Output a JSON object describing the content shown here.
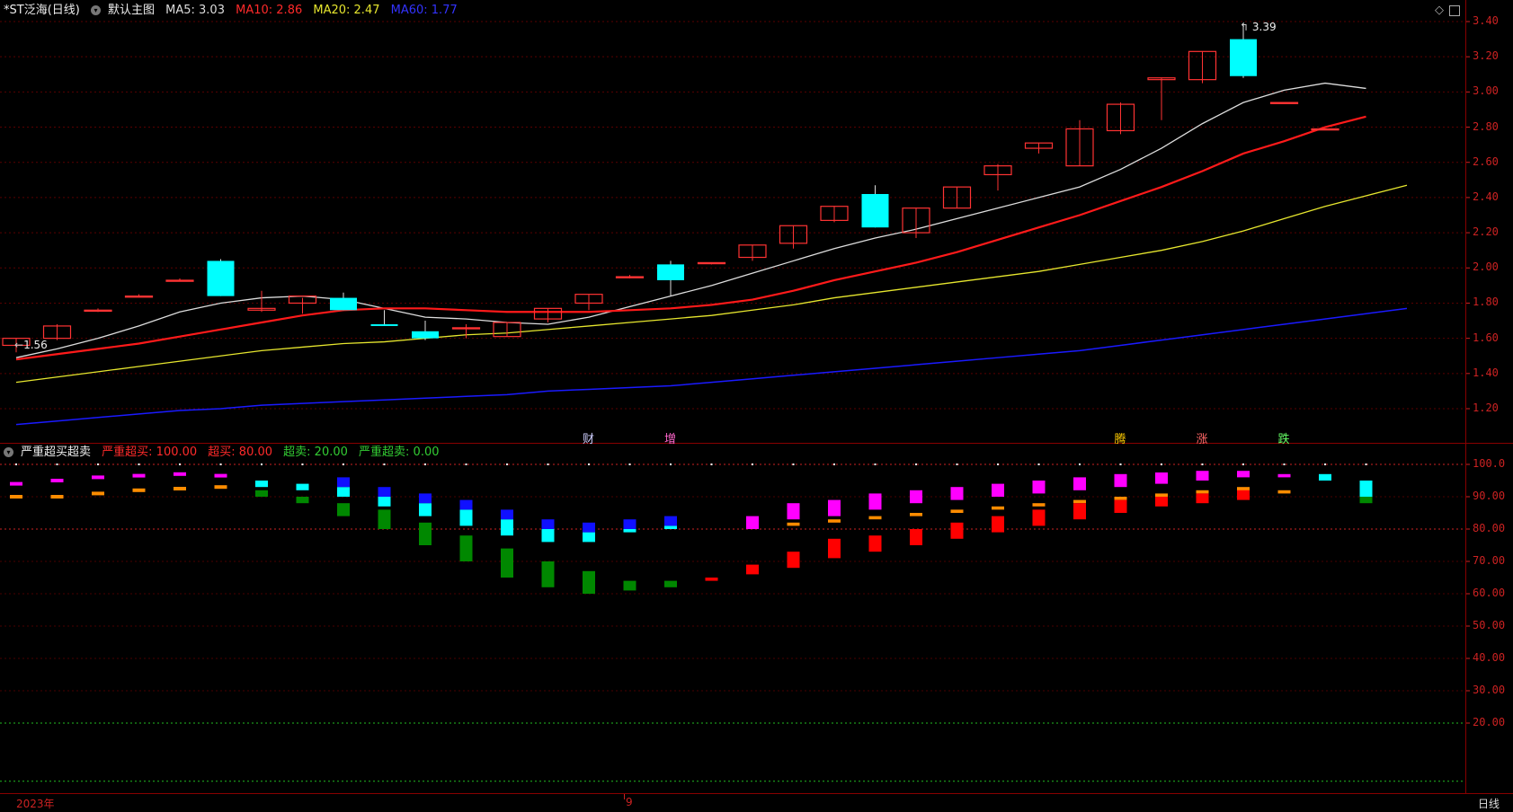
{
  "main": {
    "stock": "*ST泛海(日线)",
    "template": "默认主图",
    "ma5_label": "MA5: 3.03",
    "ma10_label": "MA10: 2.86",
    "ma20_label": "MA20: 2.47",
    "ma60_label": "MA60: 1.77",
    "colors": {
      "ma5": "#dddddd",
      "ma10": "#ff1a1a",
      "ma20": "#e6e62e",
      "ma60": "#1a1aff",
      "up": "#ff3333",
      "down": "#00ffff"
    },
    "high_label": "3.39",
    "low_label": "1.56",
    "events": [
      {
        "label": "财",
        "color": "#cfcfff"
      },
      {
        "label": "增",
        "color": "#ff66cc"
      },
      {
        "label": "腾",
        "color": "#ffcc00"
      },
      {
        "label": "涨",
        "color": "#ff6666"
      },
      {
        "label": "跌",
        "color": "#66ff66"
      }
    ],
    "ticks": [
      "3.40",
      "3.20",
      "3.00",
      "2.80",
      "2.60",
      "2.40",
      "2.20",
      "2.00",
      "1.80",
      "1.60",
      "1.40",
      "1.20"
    ]
  },
  "indicator": {
    "name": "严重超买超卖",
    "l1": "严重超买: 100.00",
    "l2": "超买: 80.00",
    "l3": "超卖: 20.00",
    "l4": "严重超卖: 0.00",
    "ticks": [
      "100.0",
      "90.00",
      "80.00",
      "70.00",
      "60.00",
      "50.00",
      "40.00",
      "30.00",
      "20.00"
    ]
  },
  "footer": {
    "year": "2023年",
    "month": "9",
    "period": "日线"
  },
  "chart_data": [
    {
      "type": "candlestick",
      "title": "*ST泛海(日线)",
      "ylim": [
        1.1,
        3.45
      ],
      "candles": [
        {
          "o": 1.56,
          "h": 1.6,
          "l": 1.52,
          "c": 1.6
        },
        {
          "o": 1.6,
          "h": 1.68,
          "l": 1.59,
          "c": 1.67
        },
        {
          "o": 1.76,
          "h": 1.77,
          "l": 1.75,
          "c": 1.76
        },
        {
          "o": 1.84,
          "h": 1.85,
          "l": 1.84,
          "c": 1.84
        },
        {
          "o": 1.93,
          "h": 1.94,
          "l": 1.93,
          "c": 1.93
        },
        {
          "o": 2.04,
          "h": 2.05,
          "l": 1.84,
          "c": 1.84
        },
        {
          "o": 1.76,
          "h": 1.87,
          "l": 1.75,
          "c": 1.77
        },
        {
          "o": 1.8,
          "h": 1.83,
          "l": 1.74,
          "c": 1.84
        },
        {
          "o": 1.83,
          "h": 1.86,
          "l": 1.76,
          "c": 1.76
        },
        {
          "o": 1.68,
          "h": 1.76,
          "l": 1.67,
          "c": 1.67
        },
        {
          "o": 1.64,
          "h": 1.7,
          "l": 1.59,
          "c": 1.6
        },
        {
          "o": 1.66,
          "h": 1.68,
          "l": 1.6,
          "c": 1.66
        },
        {
          "o": 1.61,
          "h": 1.69,
          "l": 1.61,
          "c": 1.69
        },
        {
          "o": 1.71,
          "h": 1.77,
          "l": 1.69,
          "c": 1.77
        },
        {
          "o": 1.8,
          "h": 1.85,
          "l": 1.76,
          "c": 1.85
        },
        {
          "o": 1.95,
          "h": 1.96,
          "l": 1.94,
          "c": 1.95
        },
        {
          "o": 2.02,
          "h": 2.04,
          "l": 1.84,
          "c": 1.93
        },
        {
          "o": 2.03,
          "h": 2.03,
          "l": 2.02,
          "c": 2.03
        },
        {
          "o": 2.06,
          "h": 2.13,
          "l": 2.04,
          "c": 2.13
        },
        {
          "o": 2.14,
          "h": 2.24,
          "l": 2.11,
          "c": 2.24
        },
        {
          "o": 2.27,
          "h": 2.35,
          "l": 2.26,
          "c": 2.35
        },
        {
          "o": 2.42,
          "h": 2.47,
          "l": 2.23,
          "c": 2.23
        },
        {
          "o": 2.2,
          "h": 2.34,
          "l": 2.17,
          "c": 2.34
        },
        {
          "o": 2.34,
          "h": 2.46,
          "l": 2.34,
          "c": 2.46
        },
        {
          "o": 2.53,
          "h": 2.59,
          "l": 2.44,
          "c": 2.58
        },
        {
          "o": 2.68,
          "h": 2.71,
          "l": 2.65,
          "c": 2.71
        },
        {
          "o": 2.58,
          "h": 2.84,
          "l": 2.58,
          "c": 2.79
        },
        {
          "o": 2.78,
          "h": 2.94,
          "l": 2.76,
          "c": 2.93
        },
        {
          "o": 3.07,
          "h": 3.08,
          "l": 2.84,
          "c": 3.08
        },
        {
          "o": 3.07,
          "h": 3.23,
          "l": 3.05,
          "c": 3.23
        },
        {
          "o": 3.3,
          "h": 3.39,
          "l": 3.08,
          "c": 3.09
        },
        {
          "o": 2.94,
          "h": 2.94,
          "l": 2.94,
          "c": 2.94
        },
        {
          "o": 2.79,
          "h": 2.79,
          "l": 2.79,
          "c": 2.79
        }
      ],
      "series": [
        {
          "name": "MA5",
          "values": [
            1.49,
            1.54,
            1.6,
            1.67,
            1.75,
            1.8,
            1.83,
            1.84,
            1.82,
            1.77,
            1.72,
            1.71,
            1.69,
            1.68,
            1.72,
            1.78,
            1.84,
            1.9,
            1.97,
            2.04,
            2.11,
            2.17,
            2.22,
            2.28,
            2.34,
            2.4,
            2.46,
            2.56,
            2.68,
            2.82,
            2.94,
            3.01,
            3.05,
            3.02
          ]
        },
        {
          "name": "MA10",
          "values": [
            1.48,
            1.51,
            1.54,
            1.57,
            1.61,
            1.65,
            1.69,
            1.73,
            1.76,
            1.77,
            1.77,
            1.76,
            1.75,
            1.75,
            1.75,
            1.76,
            1.77,
            1.79,
            1.82,
            1.87,
            1.93,
            1.98,
            2.03,
            2.09,
            2.16,
            2.23,
            2.3,
            2.38,
            2.46,
            2.55,
            2.65,
            2.72,
            2.8,
            2.86
          ]
        },
        {
          "name": "MA20",
          "values": [
            1.35,
            1.38,
            1.41,
            1.44,
            1.47,
            1.5,
            1.53,
            1.55,
            1.57,
            1.58,
            1.6,
            1.62,
            1.63,
            1.65,
            1.67,
            1.69,
            1.71,
            1.73,
            1.76,
            1.79,
            1.83,
            1.86,
            1.89,
            1.92,
            1.95,
            1.98,
            2.02,
            2.06,
            2.1,
            2.15,
            2.21,
            2.28,
            2.35,
            2.41,
            2.47
          ]
        },
        {
          "name": "MA60",
          "values": [
            1.11,
            1.13,
            1.15,
            1.17,
            1.19,
            1.2,
            1.22,
            1.23,
            1.24,
            1.25,
            1.26,
            1.27,
            1.28,
            1.3,
            1.31,
            1.32,
            1.33,
            1.35,
            1.37,
            1.39,
            1.41,
            1.43,
            1.45,
            1.47,
            1.49,
            1.51,
            1.53,
            1.56,
            1.59,
            1.62,
            1.65,
            1.68,
            1.71,
            1.74,
            1.77
          ]
        }
      ]
    },
    {
      "type": "bar",
      "title": "严重超买超卖",
      "ylim": [
        15,
        102
      ],
      "bars": [
        {
          "m": 94,
          "o": 90,
          "c": null,
          "g": null
        },
        {
          "m": 95,
          "o": 90,
          "c": null,
          "g": null
        },
        {
          "m": 96,
          "o": 91,
          "c": null,
          "g": null
        },
        {
          "m": 96.5,
          "o": 92,
          "c": null,
          "g": null
        },
        {
          "m": 97,
          "o": 92.5,
          "c": null,
          "g": null
        },
        {
          "m": 96.5,
          "o": 93,
          "c": null,
          "g": null
        },
        {
          "m": null,
          "o": null,
          "c": [
            93,
            95
          ],
          "g": [
            90,
            92
          ]
        },
        {
          "m": null,
          "o": null,
          "c": [
            92,
            94
          ],
          "g": [
            88,
            90
          ]
        },
        {
          "m": null,
          "o": null,
          "c": [
            90,
            93
          ],
          "g": [
            84,
            88
          ]
        },
        {
          "m": null,
          "o": null,
          "c": [
            87,
            90
          ],
          "g": [
            80,
            86
          ]
        },
        {
          "m": null,
          "o": null,
          "c": [
            84,
            88
          ],
          "g": [
            75,
            82
          ]
        },
        {
          "m": null,
          "o": null,
          "c": [
            81,
            86
          ],
          "g": [
            70,
            78
          ]
        },
        {
          "m": null,
          "o": null,
          "c": [
            78,
            83
          ],
          "g": [
            65,
            74
          ]
        },
        {
          "m": null,
          "o": null,
          "c": [
            76,
            80
          ],
          "g": [
            62,
            70
          ]
        },
        {
          "m": null,
          "o": null,
          "c": [
            76,
            79
          ],
          "g": [
            60,
            67
          ]
        },
        {
          "m": null,
          "o": null,
          "c": [
            79,
            80
          ],
          "g": [
            61,
            64
          ]
        },
        {
          "m": null,
          "o": null,
          "c": [
            80,
            81
          ],
          "g": [
            62,
            64
          ]
        },
        {
          "m": null,
          "o": null,
          "r": [
            64,
            65
          ]
        },
        {
          "m": [
            80,
            84
          ],
          "o": null,
          "r": [
            66,
            69
          ]
        },
        {
          "m": [
            83,
            88
          ],
          "o": [
            81,
            82
          ],
          "r": [
            68,
            73
          ]
        },
        {
          "m": [
            84,
            89
          ],
          "o": [
            82,
            83
          ],
          "r": [
            71,
            77
          ]
        },
        {
          "m": [
            86,
            91
          ],
          "o": [
            83,
            84
          ],
          "r": [
            73,
            78
          ]
        },
        {
          "m": [
            88,
            92
          ],
          "o": [
            84,
            85
          ],
          "r": [
            75,
            80
          ]
        },
        {
          "m": [
            89,
            93
          ],
          "o": [
            85,
            86
          ],
          "r": [
            77,
            82
          ]
        },
        {
          "m": [
            90,
            94
          ],
          "o": [
            86,
            87
          ],
          "r": [
            79,
            84
          ]
        },
        {
          "m": [
            91,
            95
          ],
          "o": [
            87,
            88
          ],
          "r": [
            81,
            86
          ]
        },
        {
          "m": [
            92,
            96
          ],
          "o": [
            88,
            89
          ],
          "r": [
            83,
            88
          ]
        },
        {
          "m": [
            93,
            97
          ],
          "o": [
            89,
            90
          ],
          "r": [
            85,
            89
          ]
        },
        {
          "m": [
            94,
            97.5
          ],
          "o": [
            90,
            91
          ],
          "r": [
            87,
            90
          ]
        },
        {
          "m": [
            95,
            98
          ],
          "o": [
            91,
            92
          ],
          "r": [
            88,
            91
          ]
        },
        {
          "m": [
            96,
            98
          ],
          "o": [
            91,
            93
          ],
          "r": [
            89,
            92
          ]
        },
        {
          "m": [
            96,
            97
          ],
          "o": [
            91,
            92
          ],
          "r": null
        },
        {
          "m": null,
          "o": null,
          "c": [
            95,
            97
          ],
          "g": null
        },
        {
          "m": null,
          "o": null,
          "c": [
            90,
            95
          ],
          "g": [
            88,
            90
          ]
        }
      ]
    }
  ]
}
